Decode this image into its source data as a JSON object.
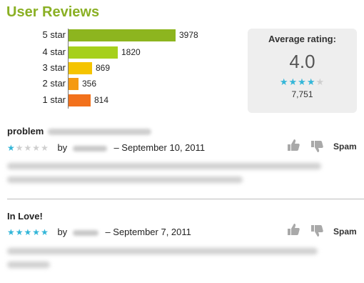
{
  "section_title": "User Reviews",
  "histogram": [
    {
      "label": "5 star",
      "count": "3978",
      "fraction": 1.0,
      "color": "#8db51f"
    },
    {
      "label": "4 star",
      "count": "1820",
      "fraction": 0.458,
      "color": "#a6d01c"
    },
    {
      "label": "3 star",
      "count": "869",
      "fraction": 0.218,
      "color": "#f5c400"
    },
    {
      "label": "2 star",
      "count": "356",
      "fraction": 0.09,
      "color": "#f59a12"
    },
    {
      "label": "1 star",
      "count": "814",
      "fraction": 0.205,
      "color": "#f2711c"
    }
  ],
  "average": {
    "caption": "Average rating:",
    "value": "4.0",
    "stars_filled": 4,
    "stars_total": 5,
    "total": "7,751"
  },
  "reviews": [
    {
      "title": "problem",
      "rating": 1,
      "by": "by",
      "date": "– September 10, 2011",
      "spam": "Spam"
    },
    {
      "title": "In Love!",
      "rating": 5,
      "by": "by",
      "date": "– September 7, 2011",
      "spam": "Spam"
    }
  ],
  "icons": {
    "thumb_up": "thumbs-up-icon",
    "thumb_down": "thumbs-down-icon",
    "star": "star-icon"
  },
  "colors": {
    "title": "#8ab024",
    "star_on": "#33b6d8",
    "star_off": "#cfcfcf"
  }
}
